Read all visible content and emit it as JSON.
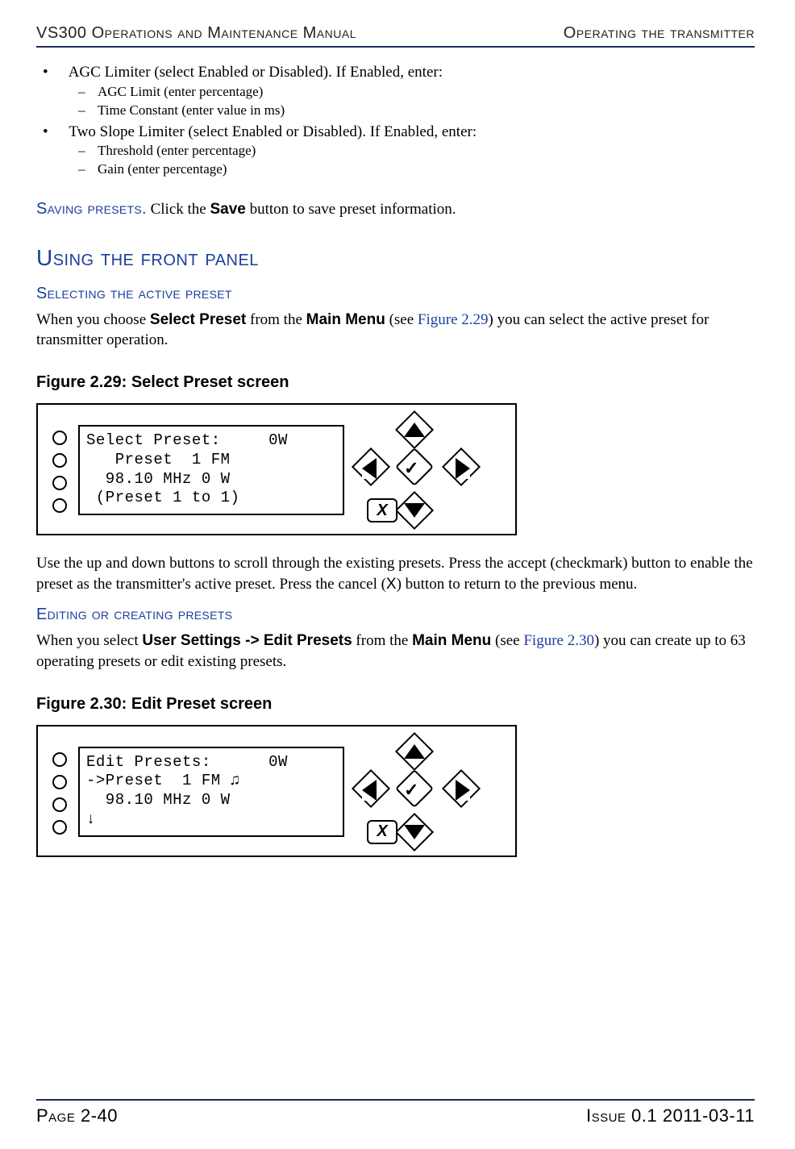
{
  "header": {
    "left": "VS300 Operations and Maintenance Manual",
    "right": "Operating the transmitter"
  },
  "bullets": {
    "agc_limiter": "AGC Limiter (select Enabled or Disabled). If Enabled, enter:",
    "agc_sub1": "AGC Limit (enter percentage)",
    "agc_sub2": "Time Constant (enter value in ms)",
    "two_slope": "Two Slope Limiter (select Enabled or Disabled). If Enabled, enter:",
    "ts_sub1": "Threshold (enter percentage)",
    "ts_sub2": "Gain (enter percentage)"
  },
  "saving": {
    "label": "Saving presets.",
    "pre": " Click the ",
    "save": "Save",
    "post": " button to save preset information."
  },
  "h2": "Using the front panel",
  "select_preset": {
    "heading": "Selecting the active preset",
    "p1_a": "When you choose ",
    "p1_b": "Select Preset",
    "p1_c": " from the ",
    "p1_d": "Main Menu",
    "p1_e": " (see ",
    "p1_ref": "Figure 2.29",
    "p1_f": ") you can select the active preset for transmitter operation."
  },
  "fig229": {
    "caption": "Figure 2.29: Select Preset screen",
    "line1": "Select Preset:     0W",
    "line2": "   Preset  1 FM",
    "line3": "  98.10 MHz 0 W",
    "line4": " (Preset 1 to 1)"
  },
  "after229_a": "Use the up and down buttons to scroll through the existing presets. Press the accept (checkmark) button to enable the preset as the transmitter's active preset. Press the cancel (",
  "after229_x": "X",
  "after229_b": ") button to return to the previous menu.",
  "edit_presets": {
    "heading": "Editing or creating presets",
    "p1_a": "When you select ",
    "p1_b": "User Settings -> Edit Presets",
    "p1_c": " from the ",
    "p1_d": "Main Menu",
    "p1_e": " (see ",
    "p1_ref": "Figure 2.30",
    "p1_f": ") you can create up to 63 operating presets or edit existing presets."
  },
  "fig230": {
    "caption": "Figure 2.30: Edit Preset screen",
    "line1": "Edit Presets:      0W",
    "line2": "->Preset  1 FM ♫",
    "line3": "  98.10 MHz 0 W",
    "line4": "↓"
  },
  "footer": {
    "left": "Page 2-40",
    "right": "Issue 0.1  2011-03-11"
  }
}
